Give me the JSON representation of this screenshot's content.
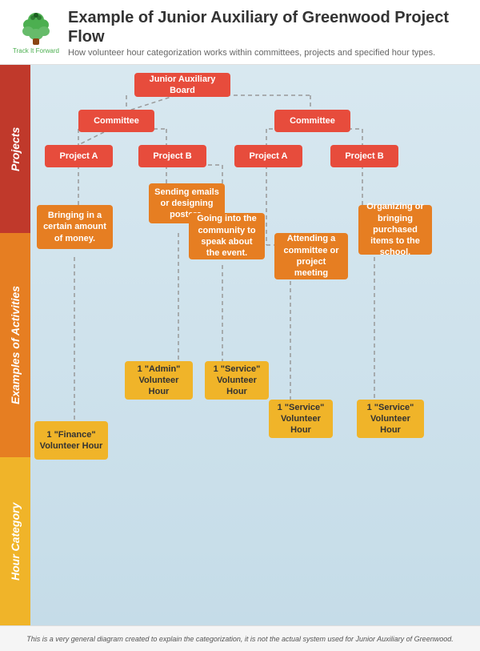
{
  "header": {
    "title": "Example of Junior Auxiliary of Greenwood Project Flow",
    "subtitle": "How volunteer hour categorization works within committees, projects and specified hour types.",
    "logo_text": "Track It Forward"
  },
  "sidebar": {
    "projects_label": "Projects",
    "activities_label": "Examples of Activities",
    "category_label": "Hour Category"
  },
  "diagram": {
    "boxes": {
      "board": "Junior Auxiliary Board",
      "committee1": "Committee",
      "committee2": "Committee",
      "project_a1": "Project A",
      "project_b1": "Project B",
      "project_a2": "Project A",
      "project_b2": "Project B",
      "activity1": "Bringing in a certain amount of money.",
      "activity2": "Sending emails or designing posters.",
      "activity3": "Going into the community to speak about the event.",
      "activity4": "Attending a committee or project meeting",
      "activity5": "Organizing or bringing purchased items to the school.",
      "hour1": "1 \"Finance\" Volunteer Hour",
      "hour2": "1 \"Admin\" Volunteer Hour",
      "hour3": "1 \"Service\" Volunteer Hour",
      "hour4": "1 \"Service\" Volunteer Hour",
      "hour5": "1 \"Service\" Volunteer Hour"
    }
  },
  "footer": {
    "text": "This is a very general diagram created to explain the categorization, it is not the actual system used for Junior Auxiliary of Greenwood."
  }
}
